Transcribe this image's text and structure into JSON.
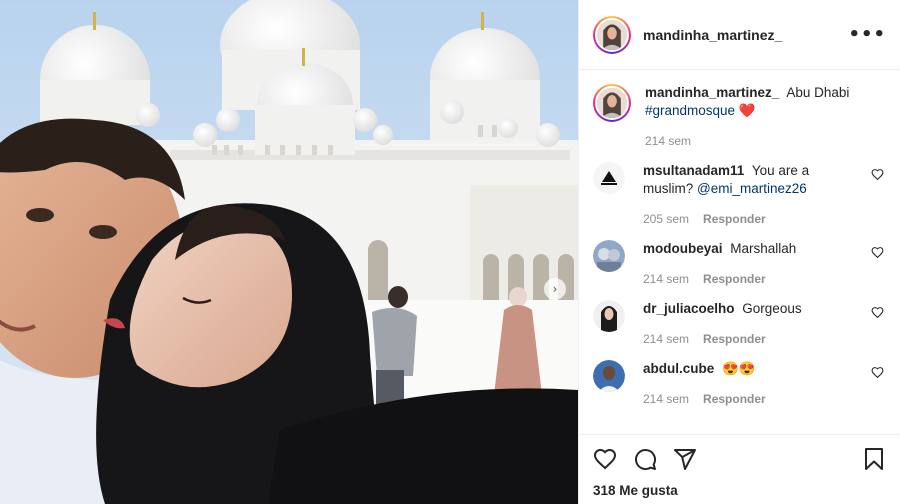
{
  "post": {
    "username": "mandinha_martinez_",
    "more_label": "•••"
  },
  "caption": {
    "username": "mandinha_martinez_",
    "text": "Abu Dhabi",
    "hashtag": "#grandmosque",
    "emoji": "❤️",
    "time": "214 sem"
  },
  "comments": [
    {
      "username": "msultanadam11",
      "text": "You are a muslim?",
      "mention": "@emi_martinez26",
      "time": "205 sem",
      "reply": "Responder"
    },
    {
      "username": "modoubeyai",
      "text": "Marshallah",
      "mention": "",
      "time": "214 sem",
      "reply": "Responder"
    },
    {
      "username": "dr_juliacoelho",
      "text": "Gorgeous",
      "mention": "",
      "time": "214 sem",
      "reply": "Responder"
    },
    {
      "username": "abdul.cube",
      "text": "😍😍",
      "mention": "",
      "time": "214 sem",
      "reply": "Responder"
    }
  ],
  "actions": {
    "likes": "318 Me gusta",
    "icons": [
      "heart-icon",
      "comment-icon",
      "share-icon",
      "bookmark-icon"
    ]
  },
  "photo": {
    "next_arrow": "›"
  },
  "colors": {
    "link": "#00376b",
    "muted": "#8e8e8e",
    "heart": "#ed4956"
  }
}
